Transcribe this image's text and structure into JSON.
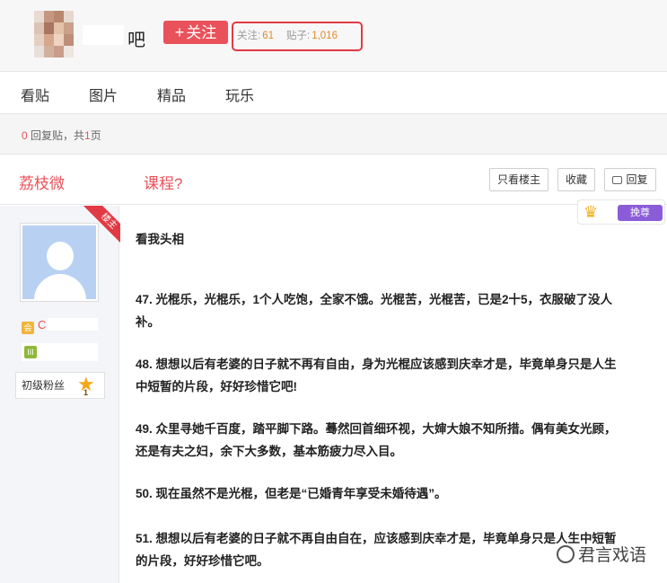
{
  "header": {
    "forum_suffix": "吧",
    "follow_label": "关注",
    "stats": {
      "follow_label": "关注:",
      "follow_count": "61",
      "posts_label": "贴子:",
      "posts_count": "1,016"
    }
  },
  "tabs": [
    {
      "label": "看贴"
    },
    {
      "label": "图片"
    },
    {
      "label": "精品"
    },
    {
      "label": "玩乐"
    }
  ],
  "page_info": {
    "reply_count": "0",
    "reply_text": "回复贴，共",
    "page_count": "1",
    "page_suffix": "页"
  },
  "thread": {
    "title_start": "荔枝微",
    "title_end": "课程?",
    "only_op_label": "只看楼主",
    "favorite_label": "收藏",
    "reply_label": "回复"
  },
  "post": {
    "op_tag": "楼主",
    "user_name_visible": "C",
    "rank_label": "初级粉丝",
    "rank_level": "1",
    "badge_label": "挽尊",
    "headline": "看我头相",
    "paragraphs": [
      {
        "line1": "47. 光棍乐，光棍乐，1个人吃饱，全家不饿。光棍苦，光棍苦，已是2十5，衣服破了没人",
        "line2": "补。"
      },
      {
        "line1": "48. 想想以后有老婆的日子就不再有自由，身为光棍应该感到庆幸才是，毕竟单身只是人生",
        "line2": "中短暂的片段，好好珍惜它吧!"
      },
      {
        "line1": "49. 众里寻她千百度，踏平脚下路。蓦然回首细环视，大婶大娘不知所措。偶有美女光顾，",
        "line2": "还是有夫之妇，余下大多数，基本筋疲力尽入目。"
      },
      {
        "line1": "50. 现在虽然不是光棍，但老是“已婚青年享受未婚待遇”。",
        "line2": ""
      },
      {
        "line1": "51. 想想以后有老婆的日子就不再自由自在，应该感到庆幸才是，毕竟单身只是人生中短暂",
        "line2": "的片段，好好珍惜它吧。"
      }
    ]
  },
  "watermark": {
    "text": "君言戏语"
  },
  "colors": {
    "accent_red": "#e9525a",
    "count_orange": "#e08a2c",
    "highlight_box": "#e23a44"
  }
}
